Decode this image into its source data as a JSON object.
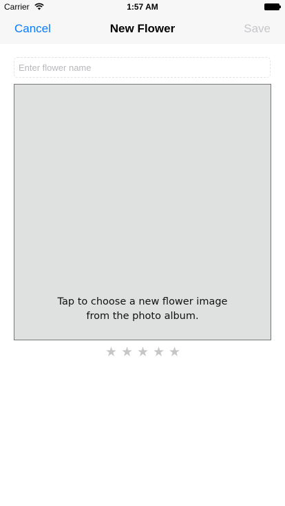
{
  "status_bar": {
    "carrier": "Carrier",
    "time": "1:57 AM",
    "wifi_icon": "wifi-icon",
    "battery_icon": "battery-icon"
  },
  "nav_bar": {
    "cancel_label": "Cancel",
    "title": "New Flower",
    "save_label": "Save",
    "accent_color": "#0a7aff",
    "disabled_color": "#c7c7cc"
  },
  "name_field": {
    "placeholder": "Enter flower name",
    "value": ""
  },
  "photo": {
    "caption": "Tap to choose a new flower image\nfrom the photo album.",
    "background_color": "#dfe0e0"
  },
  "rating": {
    "value": 0,
    "max": 5,
    "star_icon": "star-icon",
    "star_color": "#c6c6c6"
  }
}
